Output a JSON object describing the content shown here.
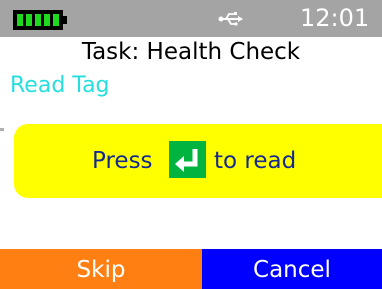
{
  "status_bar": {
    "time": "12:01",
    "battery_icon": "battery-full-icon",
    "usb_icon": "usb-icon",
    "background": "#a4a4a4"
  },
  "task": {
    "title": "Task: Health Check"
  },
  "step": {
    "label": "Read Tag",
    "color": "#27dede"
  },
  "prompt": {
    "press_text": "Press",
    "after_text": "to read",
    "key_icon": "enter-key-icon",
    "key_color": "#00b43f",
    "background": "#ffff00",
    "text_color": "#142a8f"
  },
  "buttons": {
    "skip_label": "Skip",
    "skip_color": "#ff7f12",
    "cancel_label": "Cancel",
    "cancel_color": "#0000ff"
  }
}
